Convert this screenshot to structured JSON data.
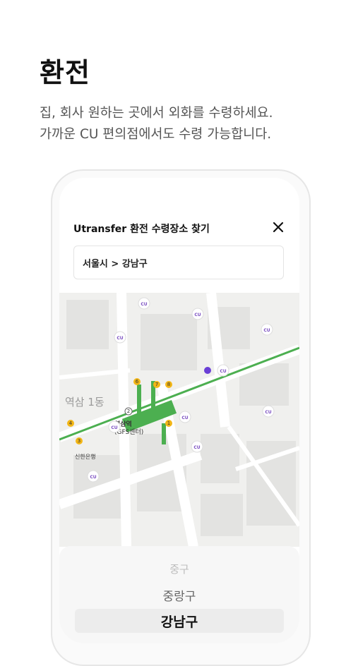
{
  "page": {
    "title": "환전",
    "subtitle_line1": "집, 회사 원하는 곳에서 외화를 수령하세요.",
    "subtitle_line2": "가까운 CU 편의점에서도 수령 가능합니다."
  },
  "modal": {
    "title": "Utransfer 환전 수령장소 찾기",
    "close_icon": "close-icon",
    "region_value": "서울시 > 강남구"
  },
  "map": {
    "area_label": "역삼 1동",
    "station_label": "역삼역",
    "station_sub": "(GFS센터)",
    "bank_label": "신한은행",
    "pins": [
      "CU",
      "CU",
      "CU",
      "CU",
      "CU",
      "CU",
      "CU",
      "CU",
      "CU",
      "CU"
    ],
    "colors": {
      "subway_line": "#4caf50",
      "cu_pin": "#7b4fc2",
      "selected_dot": "#6a3fd6"
    }
  },
  "picker": {
    "items": [
      "중구",
      "중랑구",
      "강남구"
    ],
    "selected": "강남구"
  }
}
